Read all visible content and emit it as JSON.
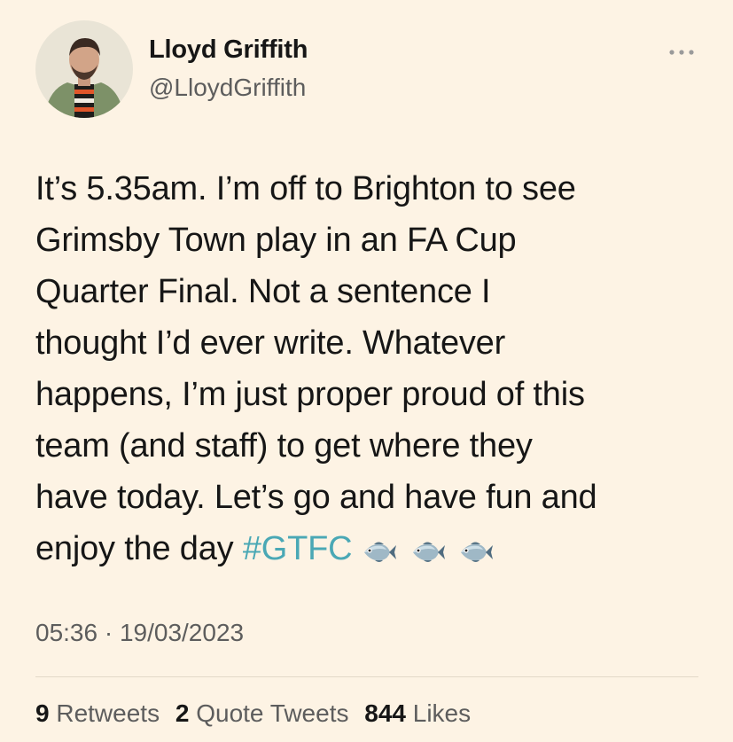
{
  "author": {
    "name": "Lloyd Griffith",
    "handle": "@LloydGriffith"
  },
  "more_icon": "ellipsis-icon",
  "tweet": {
    "lines": [
      "It’s 5.35am. I’m off to Brighton to see",
      "Grimsby Town play in an FA Cup",
      "Quarter Final. Not a sentence I",
      "thought I’d ever write. Whatever",
      "happens, I’m just proper proud of this",
      "team (and staff) to get where they",
      "have today. Let’s go and have fun and"
    ],
    "last_line_text": "enjoy the day ",
    "hashtag": "#GTFC",
    "emoji": [
      "fish-icon",
      "fish-icon",
      "fish-icon"
    ]
  },
  "timestamp": "05:36 · 19/03/2023",
  "stats": {
    "retweets": {
      "count": "9",
      "label": "Retweets"
    },
    "quote_tweets": {
      "count": "2",
      "label": "Quote Tweets"
    },
    "likes": {
      "count": "844",
      "label": "Likes"
    }
  },
  "colors": {
    "background": "#fdf3e4",
    "text": "#161616",
    "secondary_text": "#5d5d5d",
    "hashtag": "#4aa8b5"
  }
}
